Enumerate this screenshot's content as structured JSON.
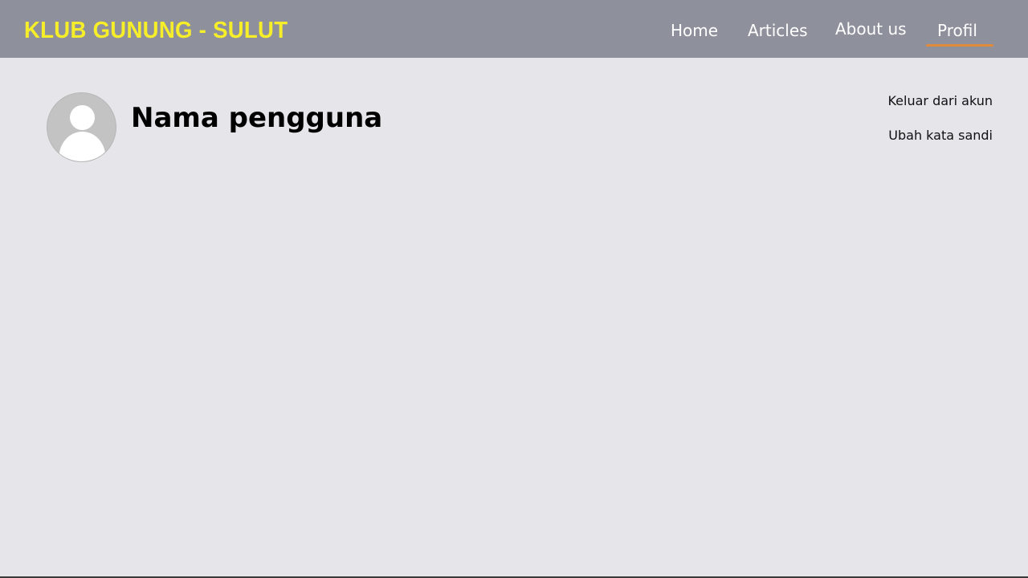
{
  "header": {
    "brand": "KLUB GUNUNG - SULUT",
    "nav": {
      "home": "Home",
      "articles": "Articles",
      "about": "About us",
      "profil": "Profil"
    },
    "active_item": "Profil"
  },
  "profile": {
    "avatar_icon": "user-placeholder-icon",
    "username": "Nama pengguna"
  },
  "actions": {
    "logout": "Keluar dari akun",
    "change_password": "Ubah kata sandi"
  },
  "colors": {
    "navbar_bg": "#8e919c",
    "brand": "#f7ee2a",
    "active_underline": "#e08a3c",
    "page_bg": "#e6e5ea"
  }
}
